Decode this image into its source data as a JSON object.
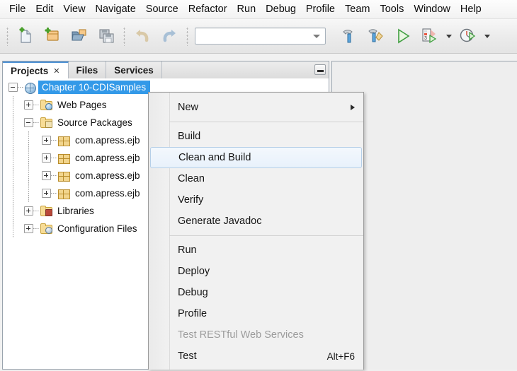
{
  "menubar": {
    "items": [
      {
        "label": "File"
      },
      {
        "label": "Edit"
      },
      {
        "label": "View"
      },
      {
        "label": "Navigate"
      },
      {
        "label": "Source"
      },
      {
        "label": "Refactor"
      },
      {
        "label": "Run"
      },
      {
        "label": "Debug"
      },
      {
        "label": "Profile"
      },
      {
        "label": "Team"
      },
      {
        "label": "Tools"
      },
      {
        "label": "Window"
      },
      {
        "label": "Help"
      }
    ]
  },
  "toolbar": {
    "buttons": [
      {
        "name": "new-file-icon"
      },
      {
        "name": "new-project-icon"
      },
      {
        "name": "open-project-icon"
      },
      {
        "name": "save-all-icon"
      },
      {
        "name": "undo-icon"
      },
      {
        "name": "redo-icon"
      },
      {
        "name": "build-project-icon"
      },
      {
        "name": "clean-and-build-project-icon"
      },
      {
        "name": "run-project-icon"
      },
      {
        "name": "debug-project-icon"
      },
      {
        "name": "profile-project-icon"
      }
    ],
    "config_combo": {
      "value": "",
      "placeholder": ""
    }
  },
  "tabs": {
    "items": [
      {
        "label": "Projects",
        "active": true,
        "closable": true,
        "close_glyph": "✕"
      },
      {
        "label": "Files",
        "active": false,
        "closable": false
      },
      {
        "label": "Services",
        "active": false,
        "closable": false
      }
    ],
    "minimize_title": "Minimize Window"
  },
  "tree": {
    "nodes": [
      {
        "label": "Chapter 10-CDISamples",
        "icon": "project-globe-icon",
        "level": 0,
        "expander": "minus",
        "selected": true
      },
      {
        "label": "Web Pages",
        "icon": "web-pages-folder-icon",
        "level": 1,
        "expander": "plus",
        "selected": false
      },
      {
        "label": "Source Packages",
        "icon": "source-packages-folder-icon",
        "level": 1,
        "expander": "minus",
        "selected": false
      },
      {
        "label": "com.apress.ejb",
        "icon": "package-icon",
        "level": 2,
        "expander": "plus",
        "selected": false
      },
      {
        "label": "com.apress.ejb",
        "icon": "package-icon",
        "level": 2,
        "expander": "plus",
        "selected": false
      },
      {
        "label": "com.apress.ejb",
        "icon": "package-icon",
        "level": 2,
        "expander": "plus",
        "selected": false
      },
      {
        "label": "com.apress.ejb",
        "icon": "package-icon",
        "level": 2,
        "expander": "plus",
        "selected": false
      },
      {
        "label": "Libraries",
        "icon": "libraries-folder-icon",
        "level": 1,
        "expander": "plus",
        "selected": false
      },
      {
        "label": "Configuration Files",
        "icon": "configuration-files-folder-icon",
        "level": 1,
        "expander": "plus",
        "selected": false
      }
    ]
  },
  "context_menu": {
    "items": [
      {
        "label": "New",
        "submenu": true,
        "disabled": false,
        "hover": false,
        "accel": ""
      },
      {
        "separator": true
      },
      {
        "label": "Build",
        "submenu": false,
        "disabled": false,
        "hover": false,
        "accel": ""
      },
      {
        "label": "Clean and Build",
        "submenu": false,
        "disabled": false,
        "hover": true,
        "accel": ""
      },
      {
        "label": "Clean",
        "submenu": false,
        "disabled": false,
        "hover": false,
        "accel": ""
      },
      {
        "label": "Verify",
        "submenu": false,
        "disabled": false,
        "hover": false,
        "accel": ""
      },
      {
        "label": "Generate Javadoc",
        "submenu": false,
        "disabled": false,
        "hover": false,
        "accel": ""
      },
      {
        "separator": true
      },
      {
        "label": "Run",
        "submenu": false,
        "disabled": false,
        "hover": false,
        "accel": ""
      },
      {
        "label": "Deploy",
        "submenu": false,
        "disabled": false,
        "hover": false,
        "accel": ""
      },
      {
        "label": "Debug",
        "submenu": false,
        "disabled": false,
        "hover": false,
        "accel": ""
      },
      {
        "label": "Profile",
        "submenu": false,
        "disabled": false,
        "hover": false,
        "accel": ""
      },
      {
        "label": "Test RESTful Web Services",
        "submenu": false,
        "disabled": true,
        "hover": false,
        "accel": ""
      },
      {
        "label": "Test",
        "submenu": false,
        "disabled": false,
        "hover": false,
        "accel": "Alt+F6"
      },
      {
        "separator": true
      }
    ]
  },
  "colors": {
    "selection_blue": "#3399e8",
    "hover_border": "#b5cfe8",
    "menu_bg": "#f1f1f1",
    "panel_border": "#9aa4ae",
    "disabled_text": "#9c9c9c"
  }
}
